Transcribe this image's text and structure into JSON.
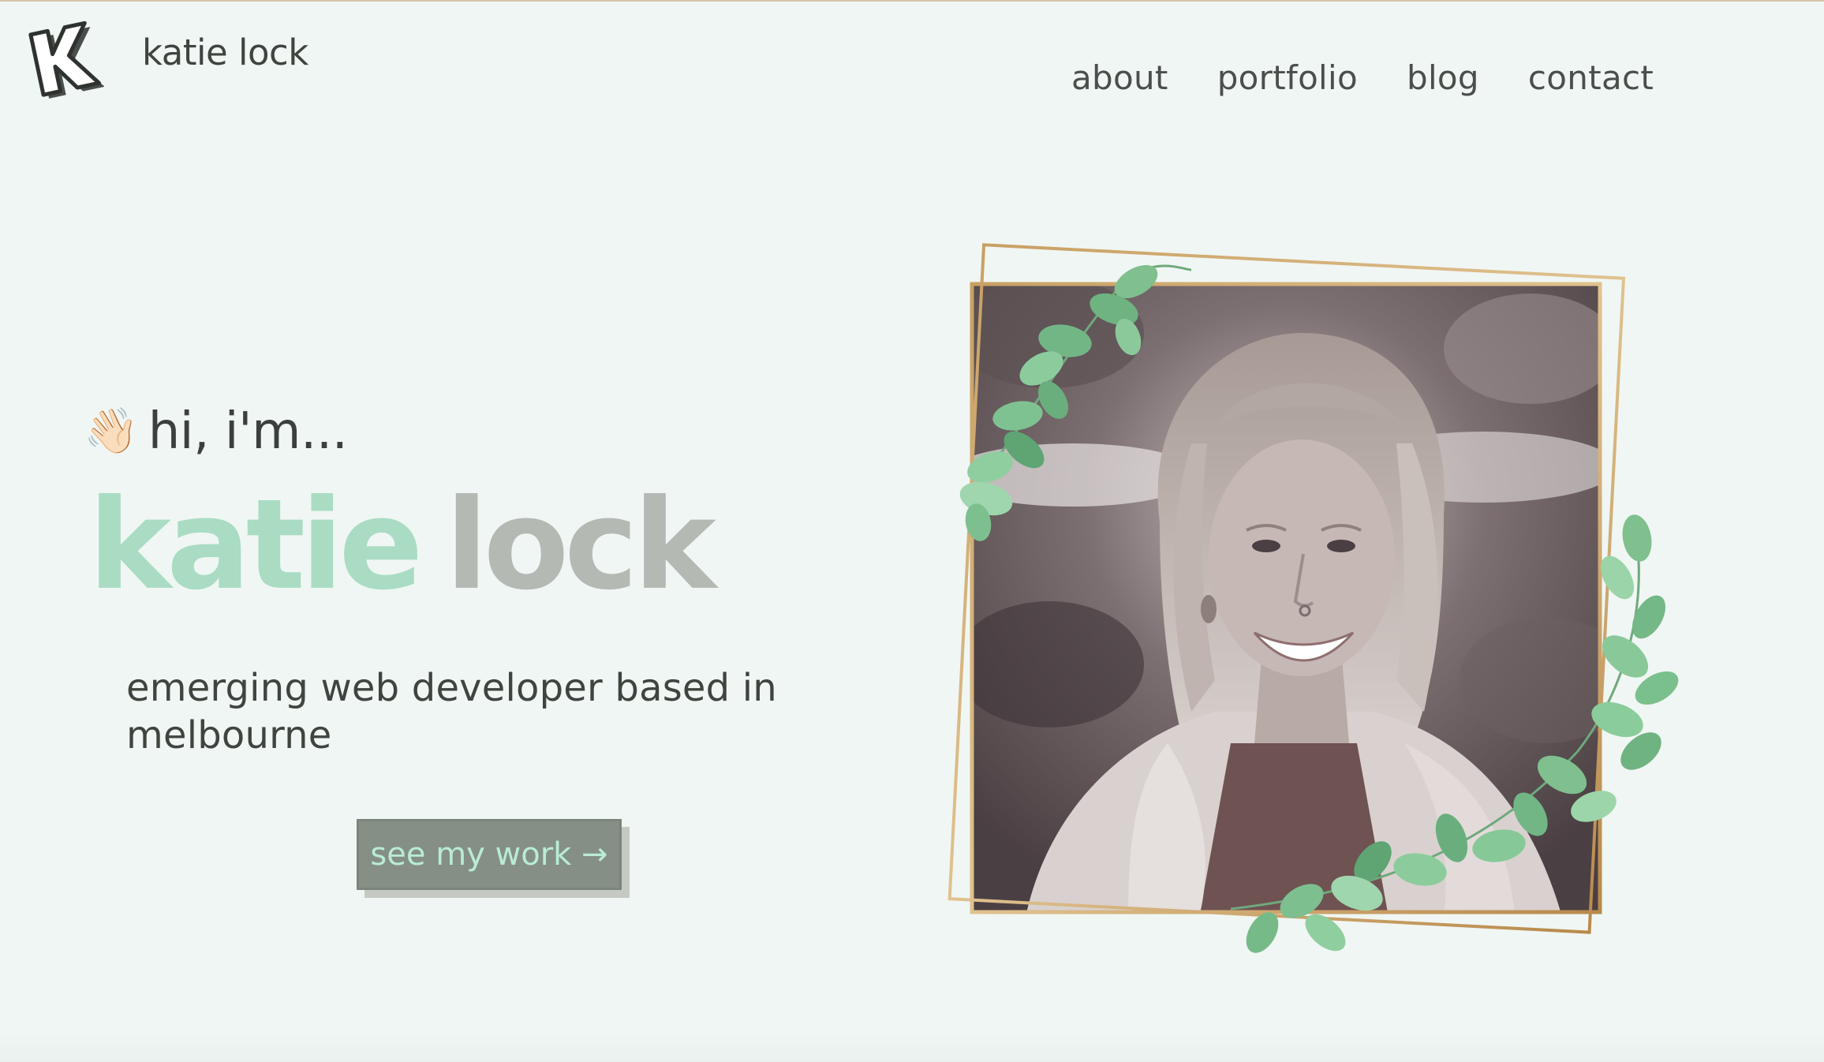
{
  "header": {
    "site_name": "katie lock",
    "logo_icon": "k-letter-logo-icon"
  },
  "nav": {
    "items": [
      {
        "label": "about"
      },
      {
        "label": "portfolio"
      },
      {
        "label": "blog"
      },
      {
        "label": "contact"
      }
    ]
  },
  "hero": {
    "wave_emoji": "👋🏻",
    "greeting": "hi, i'm...",
    "first_name": "katie",
    "last_name": "lock",
    "tagline": "emerging web developer based in melbourne",
    "cta_label": "see my work →"
  },
  "photo": {
    "subject": "portrait-photo",
    "decor": [
      "gold-frame-icon",
      "eucalyptus-leaves-icon"
    ]
  },
  "colors": {
    "background": "#f0f6f3",
    "accent_mint": "#a9dcc3",
    "name_grey": "#b5b9b4",
    "text_dark": "#3f443f",
    "button_bg": "#858f86",
    "button_text": "#b8ecd3",
    "frame_gold": "#c9a46a",
    "leaf_green": "#7fc08e"
  }
}
